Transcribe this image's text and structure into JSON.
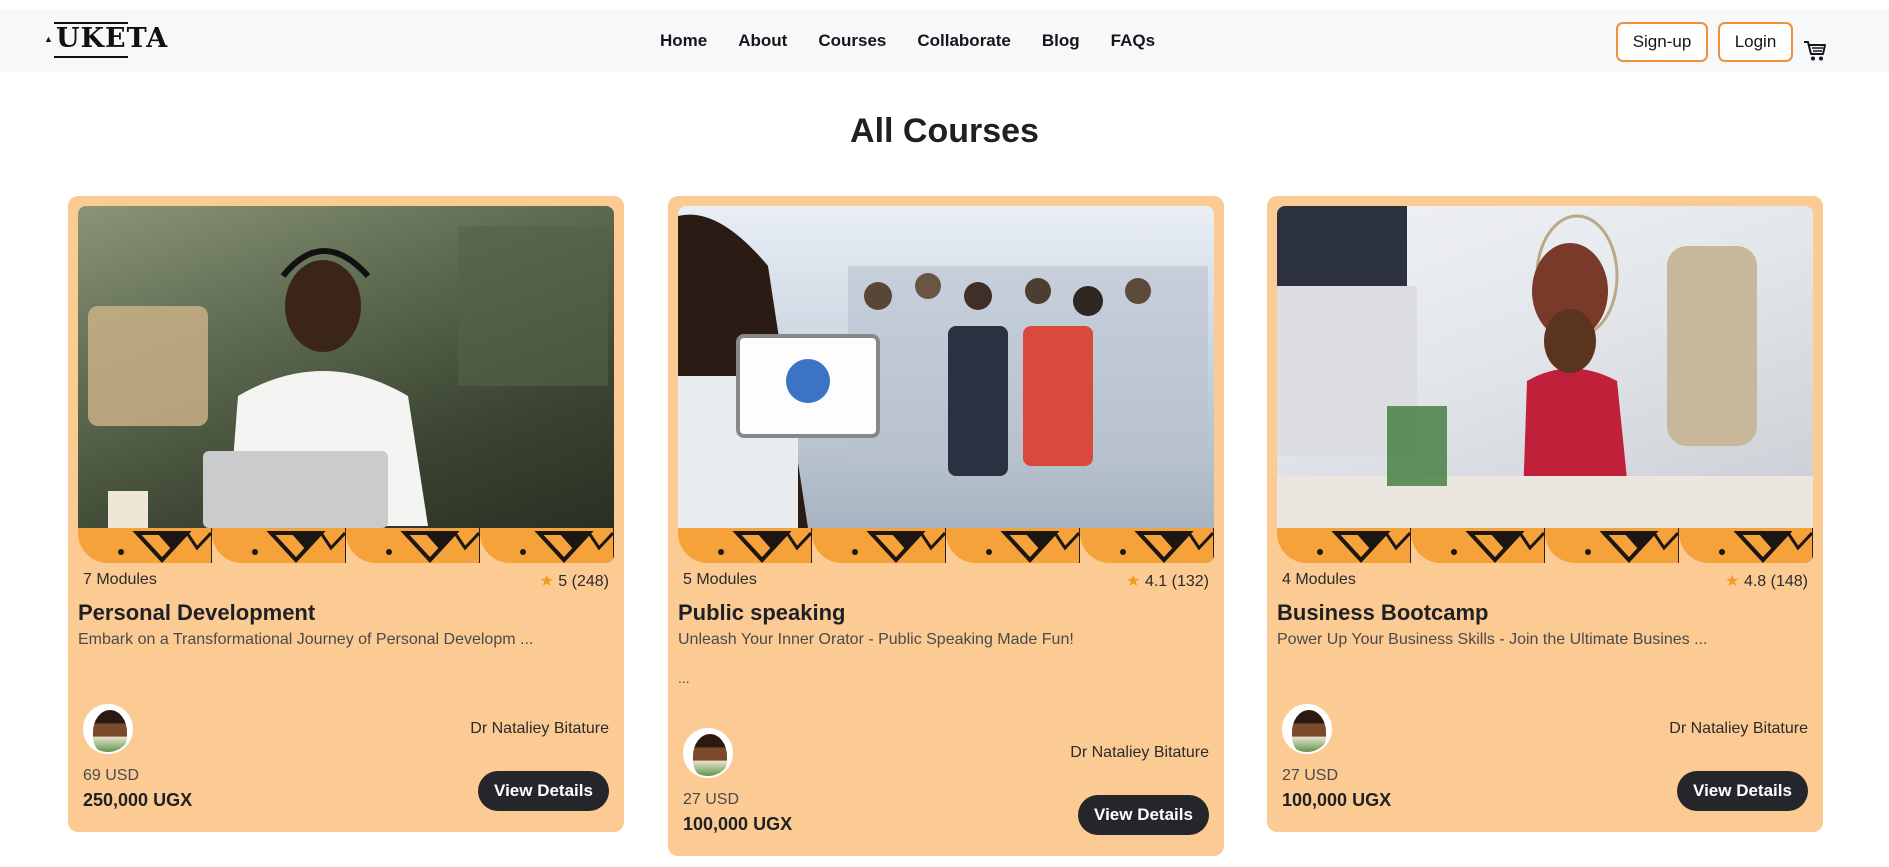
{
  "brand": {
    "logo_text": "UKETA"
  },
  "nav": {
    "links": [
      "Home",
      "About",
      "Courses",
      "Collaborate",
      "Blog",
      "FAQs"
    ],
    "signup_label": "Sign-up",
    "login_label": "Login",
    "cart_icon": "cart-icon"
  },
  "page": {
    "title": "All Courses"
  },
  "colors": {
    "card_bg": "#fccb94",
    "accent": "#f0903a",
    "pattern": "#f5a23a",
    "button_dark": "#25262b",
    "star": "#f59a1c"
  },
  "courses": [
    {
      "modules": "7 Modules",
      "rating": "5 (248)",
      "title": "Personal Development",
      "description": "Embark on a Transformational Journey of Personal Developm ...",
      "extra": "",
      "instructor": "Dr Nataliey Bitature",
      "price_usd": "69 USD",
      "price_ugx": "250,000 UGX",
      "button_label": "View Details"
    },
    {
      "modules": "5 Modules",
      "rating": "4.1 (132)",
      "title": "Public speaking",
      "description": "Unleash Your Inner Orator - Public Speaking Made Fun!",
      "extra": "...",
      "instructor": "Dr Nataliey Bitature",
      "price_usd": "27 USD",
      "price_ugx": "100,000 UGX",
      "button_label": "View Details"
    },
    {
      "modules": "4 Modules",
      "rating": "4.8 (148)",
      "title": "Business Bootcamp",
      "description": "Power Up Your Business Skills - Join the Ultimate Busines ...",
      "extra": "",
      "instructor": "Dr Nataliey Bitature",
      "price_usd": "27 USD",
      "price_ugx": "100,000 UGX",
      "button_label": "View Details"
    }
  ]
}
